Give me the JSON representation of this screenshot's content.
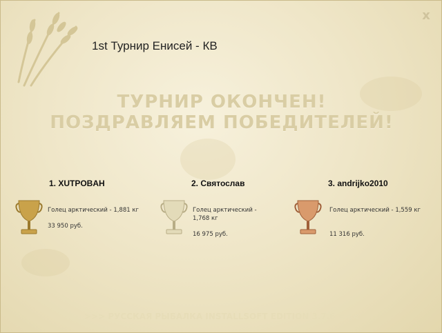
{
  "window": {
    "title": "1st Турнир Енисей - КВ",
    "close_label": "x"
  },
  "banner": {
    "line1": "ТУРНИР ОКОНЧЕН!",
    "line2": "ПОЗДРАВЛЯЕМ ПОБЕДИТЕЛЕЙ!"
  },
  "winners": [
    {
      "name": "1. XUTPOBAH",
      "fish": "Голец арктический - 1,881 кг",
      "prize": "33 950 руб.",
      "cup": "gold-cup-icon"
    },
    {
      "name": "2. Святослав",
      "fish": "Голец арктический - 1,768 кг",
      "prize": "16 975 руб.",
      "cup": "silver-cup-icon"
    },
    {
      "name": "3. andrijko2010",
      "fish": "Голец арктический - 1,559 кг",
      "prize": "11 316 руб.",
      "cup": "bronze-cup-icon"
    }
  ],
  "footer": {
    "text": ">>> РУССКАЯ РЫБАЛКА INSTALLSOFT EDITION 3.7.6 <<<"
  },
  "colors": {
    "background": "#efe6c8",
    "banner_text": "#d9cda4",
    "gold": "#c9a24a",
    "silver": "#d8d0b0",
    "bronze": "#c98a5c"
  }
}
